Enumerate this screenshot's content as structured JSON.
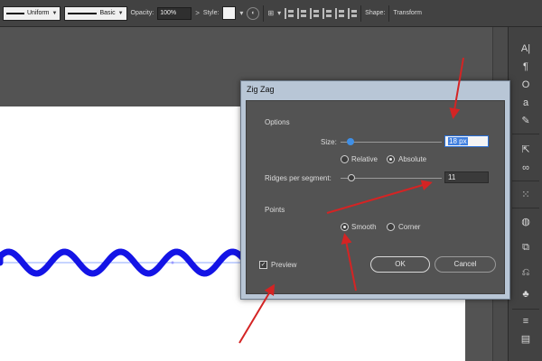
{
  "control_bar": {
    "stroke_profile": "Uniform",
    "brush": "Basic",
    "opacity_label": "Opacity:",
    "opacity_value": "100%",
    "style_label": "Style:",
    "shape_label": "Shape:",
    "transform_label": "Transform"
  },
  "dialog": {
    "title": "Zig Zag",
    "options_heading": "Options",
    "size_label": "Size:",
    "size_value": "18 px",
    "size_slider_fraction": 0.1,
    "relative_label": "Relative",
    "absolute_label": "Absolute",
    "absolute_selected": true,
    "ridges_label": "Ridges per segment:",
    "ridges_value": "11",
    "ridges_slider_fraction": 0.11,
    "points_heading": "Points",
    "smooth_label": "Smooth",
    "corner_label": "Corner",
    "smooth_selected": true,
    "preview_label": "Preview",
    "preview_checked": true,
    "ok_label": "OK",
    "cancel_label": "Cancel"
  },
  "colors": {
    "wave_stroke": "#1414e6",
    "arrow": "#d42424",
    "dialog_title_bar": "#b8c6d6",
    "dialog_panel": "#535353",
    "active_field_highlight": "#3f7fe0"
  },
  "right_panel_icons": [
    "character-icon",
    "paragraph-icon",
    "opentype-icon",
    "glyphs-icon",
    "brushes-icon",
    "export-icon",
    "links-icon",
    "transform-icon",
    "appearance-icon",
    "graphic-styles-icon",
    "artboards-icon",
    "symbols-icon",
    "layers-icon",
    "gradient-icon"
  ]
}
